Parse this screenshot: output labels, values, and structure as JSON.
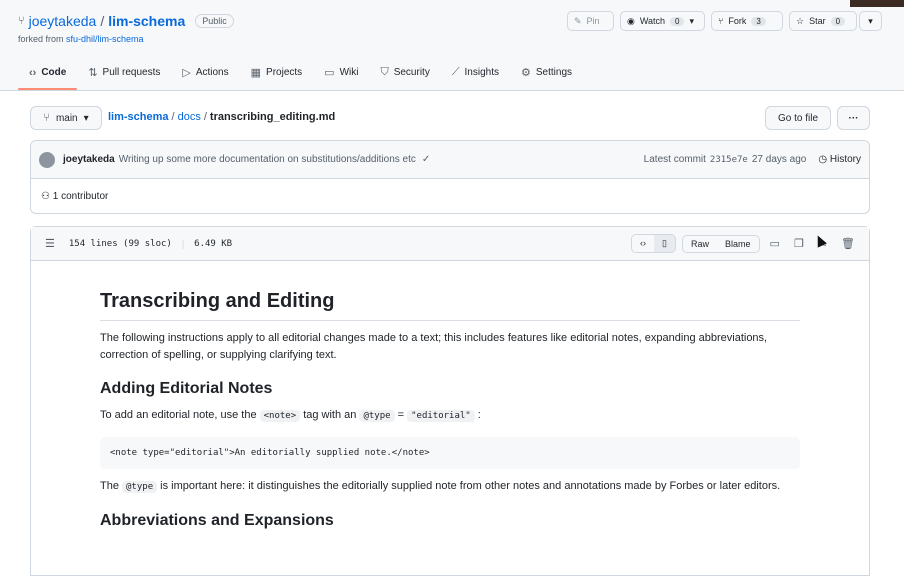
{
  "repo": {
    "owner": "joeytakeda",
    "separator": "/",
    "name": "lim-schema",
    "visibility": "Public",
    "forked_prefix": "forked from ",
    "forked_source": "sfu-dhil/lim-schema"
  },
  "actions": {
    "pin": "Pin",
    "watch": "Watch",
    "watch_count": "0",
    "fork": "Fork",
    "fork_count": "3",
    "star": "Star",
    "star_count": "0"
  },
  "tabs": [
    {
      "label": "Code",
      "icon": "code-icon"
    },
    {
      "label": "Pull requests",
      "icon": "pull-request-icon"
    },
    {
      "label": "Actions",
      "icon": "play-icon"
    },
    {
      "label": "Projects",
      "icon": "table-icon"
    },
    {
      "label": "Wiki",
      "icon": "book-icon"
    },
    {
      "label": "Security",
      "icon": "shield-icon"
    },
    {
      "label": "Insights",
      "icon": "graph-icon"
    },
    {
      "label": "Settings",
      "icon": "gear-icon"
    }
  ],
  "branch": "main",
  "breadcrumb": {
    "repo": "lim-schema",
    "folder": "docs",
    "file": "transcribing_editing.md",
    "sep": "/"
  },
  "go_to_file": "Go to file",
  "more": "···",
  "commit": {
    "user": "joeytakeda",
    "message": "Writing up some more documentation on substitutions/additions etc",
    "check": "✓",
    "latest_label": "Latest commit",
    "sha": "2315e7e",
    "age": "27 days ago",
    "history": "History"
  },
  "contributors": "1 contributor",
  "file": {
    "lines": "154 lines (99 sloc)",
    "size": "6.49 KB",
    "raw": "Raw",
    "blame": "Blame"
  },
  "doc": {
    "h1": "Transcribing and Editing",
    "p1": "The following instructions apply to all editorial changes made to a text; this includes features like editorial notes, expanding abbreviations, correction of spelling, or supplying clarifying text.",
    "h2a": "Adding Editorial Notes",
    "p2_a": "To add an editorial note, use the ",
    "p2_code1": "<note>",
    "p2_b": " tag with an ",
    "p2_code2": "@type",
    "p2_c": " = ",
    "p2_code3": "\"editorial\"",
    "p2_d": " :",
    "pre": "<note type=\"editorial\">An editorially supplied note.</note>",
    "p3_a": "The ",
    "p3_code": "@type",
    "p3_b": " is important here: it distinguishes the editorially supplied note from other notes and annotations made by Forbes or later editors.",
    "h2b": "Abbreviations and Expansions"
  }
}
